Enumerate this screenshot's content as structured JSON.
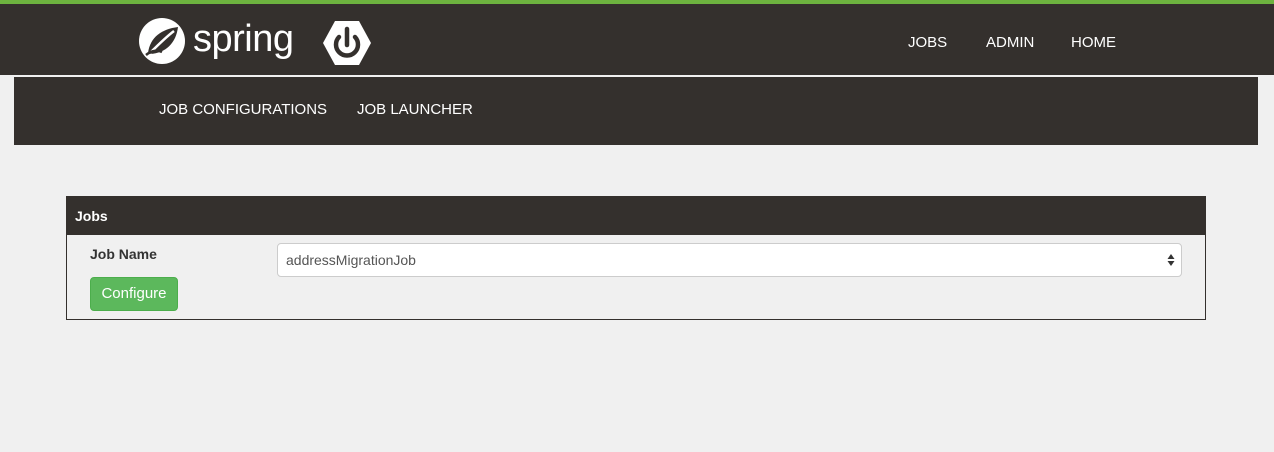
{
  "header": {
    "logo_text": "spring",
    "logo_icon": "spring-leaf-icon",
    "boot_icon": "power-icon",
    "nav": [
      "JOBS",
      "ADMIN",
      "HOME"
    ],
    "accent_color": "#6db33f",
    "bar_color": "#34302d"
  },
  "subnav": {
    "items": [
      "JOB CONFIGURATIONS",
      "JOB LAUNCHER"
    ]
  },
  "jobs_panel": {
    "title": "Jobs",
    "field_label": "Job Name",
    "selected_job": "addressMigrationJob",
    "button_label": "Configure",
    "button_color": "#5cb85c"
  }
}
